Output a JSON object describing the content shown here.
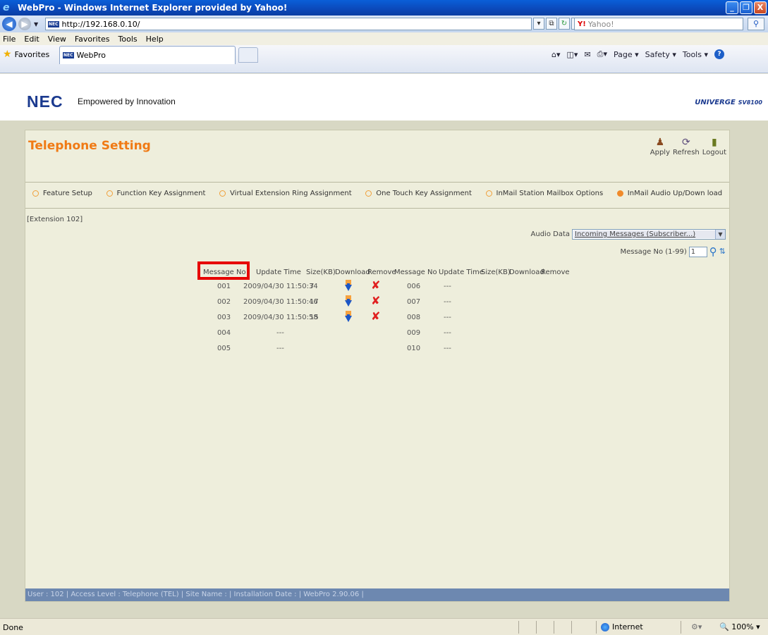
{
  "window": {
    "title": "WebPro - Windows Internet Explorer provided by Yahoo!",
    "minimize": "_",
    "restore": "❐",
    "close": "X"
  },
  "address": {
    "url": "http://192.168.0.10/",
    "search_placeholder": "Yahoo!"
  },
  "menu": [
    "File",
    "Edit",
    "View",
    "Favorites",
    "Tools",
    "Help"
  ],
  "favorites": {
    "label": "Favorites",
    "tab_label": "WebPro"
  },
  "command_bar": {
    "page": "Page",
    "safety": "Safety",
    "tools": "Tools"
  },
  "header": {
    "logo": "NEC",
    "tagline": "Empowered by Innovation",
    "product": "UNIVERGE",
    "model": "SV8100"
  },
  "panel": {
    "title": "Telephone Setting",
    "tools": {
      "apply": "Apply",
      "refresh": "Refresh",
      "logout": "Logout"
    },
    "nav": [
      {
        "label": "Feature Setup",
        "selected": false
      },
      {
        "label": "Function Key Assignment",
        "selected": false
      },
      {
        "label": "Virtual Extension Ring Assignment",
        "selected": false
      },
      {
        "label": "One Touch Key Assignment",
        "selected": false
      },
      {
        "label": "InMail Station Mailbox Options",
        "selected": false
      },
      {
        "label": "InMail Audio Up/Down load",
        "selected": true
      }
    ],
    "extension": "[Extension 102]",
    "audio_data_label": "Audio Data",
    "audio_data_value": "Incoming Messages (Subscriber...)",
    "message_no_label": "Message No (1-99)",
    "message_no_value": "1"
  },
  "table": {
    "headers": [
      "Message No",
      "Update Time",
      "Size(KB)",
      "Download",
      "Remove",
      "Message No",
      "Update Time",
      "Size(KB)",
      "Download",
      "Remove"
    ],
    "left_rows": [
      {
        "no": "001",
        "time": "2009/04/30 11:50:34",
        "size": "7",
        "has_file": true
      },
      {
        "no": "002",
        "time": "2009/04/30 11:50:46",
        "size": "17",
        "has_file": true
      },
      {
        "no": "003",
        "time": "2009/04/30 11:50:58",
        "size": "15",
        "has_file": true
      },
      {
        "no": "004",
        "time": "---",
        "size": "",
        "has_file": false
      },
      {
        "no": "005",
        "time": "---",
        "size": "",
        "has_file": false
      }
    ],
    "right_rows": [
      {
        "no": "006",
        "time": "---"
      },
      {
        "no": "007",
        "time": "---"
      },
      {
        "no": "008",
        "time": "---"
      },
      {
        "no": "009",
        "time": "---"
      },
      {
        "no": "010",
        "time": "---"
      }
    ]
  },
  "footer_status": "User : 102 | Access Level : Telephone (TEL) | Site Name : | Installation Date : | WebPro 2.90.06 |",
  "ie_status": {
    "done": "Done",
    "zone": "Internet",
    "zoom": "100%"
  },
  "colors": {
    "accent_orange": "#f07a14",
    "nec_blue": "#1b3a8f",
    "highlight_red": "#e60000"
  }
}
